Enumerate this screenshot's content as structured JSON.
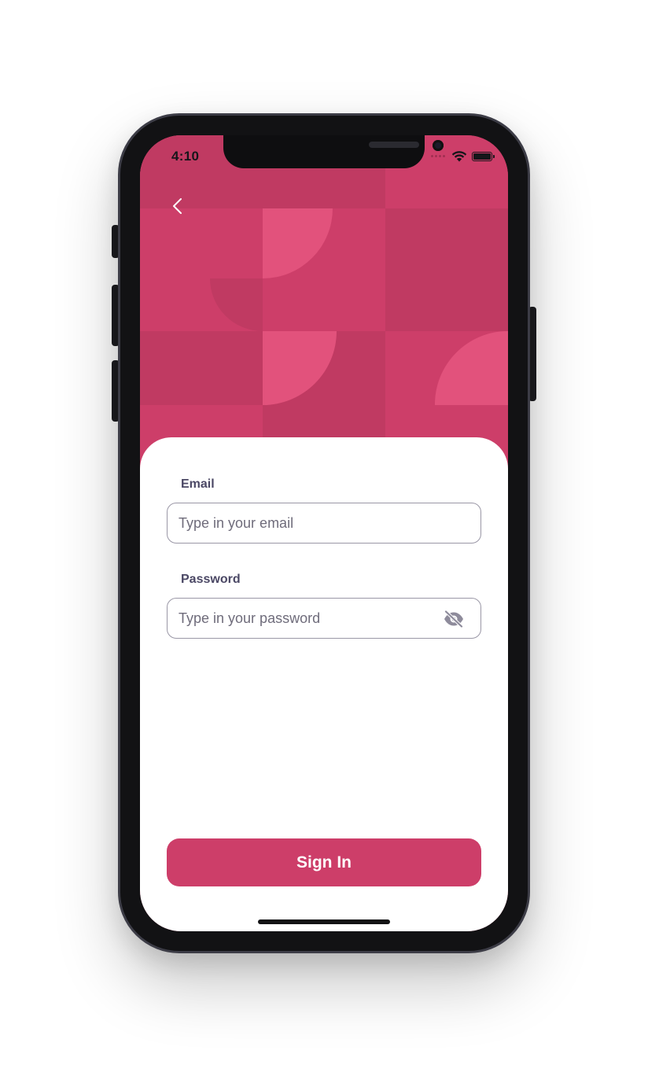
{
  "status_bar": {
    "time": "4:10"
  },
  "header": {
    "back_icon": "chevron-left-icon"
  },
  "form": {
    "email": {
      "label": "Email",
      "placeholder": "Type in your email",
      "value": ""
    },
    "password": {
      "label": "Password",
      "placeholder": "Type in your password",
      "value": "",
      "toggle_icon": "eye-off-icon"
    },
    "submit_label": "Sign In"
  },
  "colors": {
    "brand": "#cd3e69",
    "pattern_dark": "#c03a62",
    "pattern_light": "#e2527c",
    "label_text": "#4b4865"
  }
}
